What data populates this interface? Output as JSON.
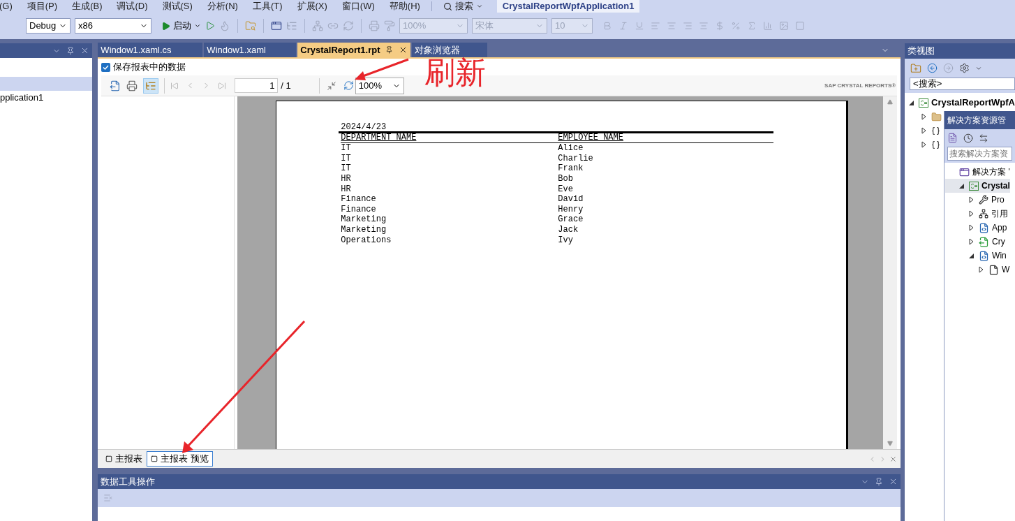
{
  "menu_bar": {
    "items": [
      "(G)",
      "项目(P)",
      "生成(B)",
      "调试(D)",
      "测试(S)",
      "分析(N)",
      "工具(T)",
      "扩展(X)",
      "窗口(W)",
      "帮助(H)"
    ],
    "search": "搜索",
    "solution_title": "CrystalReportWpfApplication1"
  },
  "toolbar": {
    "configuration": "Debug",
    "platform": "x86",
    "start": "启动",
    "zoom": {
      "value": "100%",
      "disabled": true
    },
    "font": {
      "value": "宋体",
      "disabled": true
    },
    "font_size": {
      "value": "10",
      "disabled": true
    }
  },
  "left_panel": {
    "rows": [
      {
        "selected": true
      },
      {
        "label": "pplication1",
        "selected": false
      }
    ]
  },
  "document_tabs": [
    {
      "label": "Window1.xaml.cs",
      "selected": false
    },
    {
      "label": "Window1.xaml",
      "selected": false
    },
    {
      "label": "CrystalReport1.rpt",
      "selected": true
    },
    {
      "label": "对象浏览器",
      "selected": false
    }
  ],
  "report_designer": {
    "save_data": {
      "label": "保存报表中的数据",
      "checked": true
    },
    "viewer_toolbar": {
      "page": "1",
      "page_total": "/ 1",
      "zoom": "100%",
      "brand": "SAP CRYSTAL REPORTS®"
    },
    "report": {
      "date": "2024/4/23",
      "columns": [
        "DEPARTMENT_NAME",
        "EMPLOYEE_NAME"
      ],
      "rows": [
        [
          "IT",
          "Alice"
        ],
        [
          "IT",
          "Charlie"
        ],
        [
          "IT",
          "Frank"
        ],
        [
          "HR",
          "Bob"
        ],
        [
          "HR",
          "Eve"
        ],
        [
          "Finance",
          "David"
        ],
        [
          "Finance",
          "Henry"
        ],
        [
          "Marketing",
          "Grace"
        ],
        [
          "Marketing",
          "Jack"
        ],
        [
          "Operations",
          "Ivy"
        ]
      ]
    },
    "bottom_tabs": [
      {
        "label": "主报表",
        "selected": false
      },
      {
        "label": "主报表 预览",
        "selected": true
      }
    ]
  },
  "annotation": {
    "text": "刷新"
  },
  "data_tools_panel": {
    "title": "数据工具操作"
  },
  "class_view": {
    "title": "类视图",
    "search": "<搜索>",
    "tree": [
      {
        "label": "CrystalReportWpfA",
        "kind": "project",
        "expanded": true,
        "children": [
          {
            "kind": "folder",
            "expanded": false
          },
          {
            "kind": "namespace",
            "expanded": false
          },
          {
            "kind": "namespace",
            "expanded": false
          }
        ]
      }
    ]
  },
  "solution_explorer": {
    "title": "解决方案资源管",
    "search_placeholder": "搜索解决方案资",
    "tree": [
      {
        "label": "解决方案 '",
        "kind": "solution",
        "selected": false,
        "children": [
          {
            "label": "Crystal",
            "kind": "project",
            "selected": true,
            "expanded": true,
            "children": [
              {
                "label": "Pro",
                "kind": "properties",
                "selected": false,
                "expanded": false
              },
              {
                "label": "引用",
                "kind": "references",
                "selected": false,
                "expanded": false
              },
              {
                "label": "App",
                "kind": "xaml",
                "selected": false,
                "expanded": false
              },
              {
                "label": "Cry",
                "kind": "report",
                "selected": false,
                "expanded": false
              },
              {
                "label": "Win",
                "kind": "xaml",
                "selected": false,
                "expanded": true,
                "children": [
                  {
                    "label": "W",
                    "kind": "code",
                    "selected": false,
                    "expanded": false
                  }
                ]
              }
            ]
          }
        ]
      }
    ]
  }
}
